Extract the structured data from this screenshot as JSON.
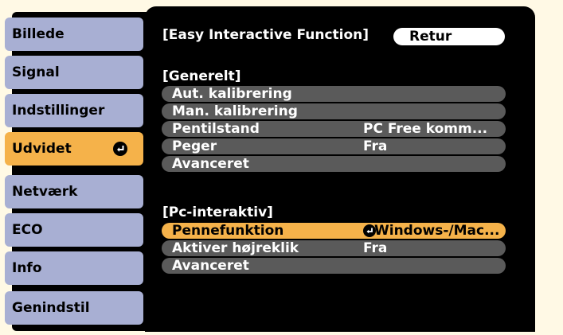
{
  "sidebar": {
    "items": [
      {
        "label": "Billede"
      },
      {
        "label": "Signal"
      },
      {
        "label": "Indstillinger"
      },
      {
        "label": "Udvidet"
      },
      {
        "label": "Netværk"
      },
      {
        "label": "ECO"
      },
      {
        "label": "Info"
      },
      {
        "label": "Genindstil"
      }
    ],
    "active_index": 3
  },
  "panel": {
    "title": "[Easy Interactive Function]",
    "return_label": "Retur",
    "sections": [
      {
        "header": "[Generelt]",
        "rows": [
          {
            "label": "Aut. kalibrering",
            "value": ""
          },
          {
            "label": "Man. kalibrering",
            "value": ""
          },
          {
            "label": "Pentilstand",
            "value": "PC Free komm..."
          },
          {
            "label": "Peger",
            "value": "Fra"
          },
          {
            "label": "Avanceret",
            "value": ""
          }
        ]
      },
      {
        "header": "[Pc-interaktiv]",
        "rows": [
          {
            "label": "Pennefunktion",
            "value": "Windows-/Mac..."
          },
          {
            "label": "Aktiver højreklik",
            "value": "Fra"
          },
          {
            "label": "Avanceret",
            "value": ""
          }
        ]
      }
    ]
  },
  "colors": {
    "menu_item": "#a8afd3",
    "highlight": "#f5b24a",
    "panel_bg": "#000000",
    "row_bg": "#5a5a5a"
  }
}
